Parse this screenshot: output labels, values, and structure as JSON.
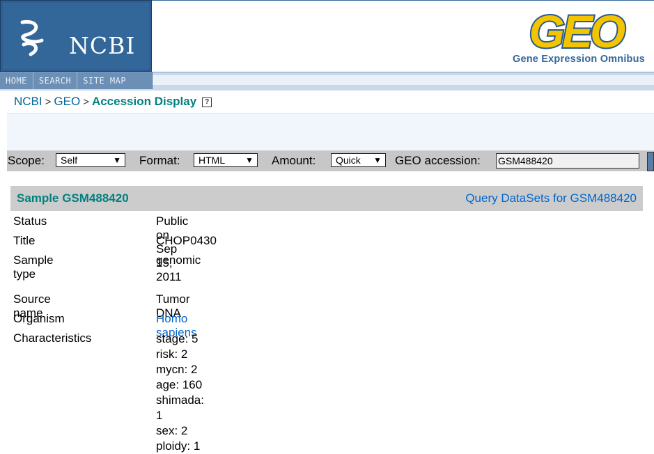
{
  "header": {
    "ncbi_logo_text": "NCBI",
    "nav": [
      "HOME",
      "SEARCH",
      "SITE MAP"
    ],
    "geo_logo_text": "GEO",
    "geo_tagline": "Gene Expression Omnibus"
  },
  "breadcrumb": {
    "items": [
      "NCBI",
      "GEO"
    ],
    "separator": ">",
    "current": "Accession Display",
    "help": "?"
  },
  "query_bar": {
    "scope_label": "Scope:",
    "scope_value": "Self",
    "format_label": "Format:",
    "format_value": "HTML",
    "amount_label": "Amount:",
    "amount_value": "Quick",
    "accession_label": "GEO accession:",
    "accession_value": "GSM488420"
  },
  "sample": {
    "title": "Sample GSM488420",
    "query_link": "Query DataSets for GSM488420"
  },
  "details": {
    "status_label": "Status",
    "status_value": "Public on Sep 15, 2011",
    "title_label": "Title",
    "title_value": "CHOP0430",
    "sample_type_label": "Sample type",
    "sample_type_value": "genomic",
    "source_name_label": "Source name",
    "source_name_value": "Tumor DNA",
    "organism_label": "Organism",
    "organism_value": "Homo sapiens",
    "characteristics_label": "Characteristics",
    "characteristics": [
      "stage: 5",
      "risk: 2",
      "mycn: 2",
      "age: 160",
      "shimada: 1",
      "sex: 2",
      "ploidy: 1"
    ]
  },
  "colors": {
    "ncbi_blue": "#336699",
    "teal_heading": "#008080",
    "link_blue": "#0066cc",
    "geo_yellow": "#f5c400"
  }
}
